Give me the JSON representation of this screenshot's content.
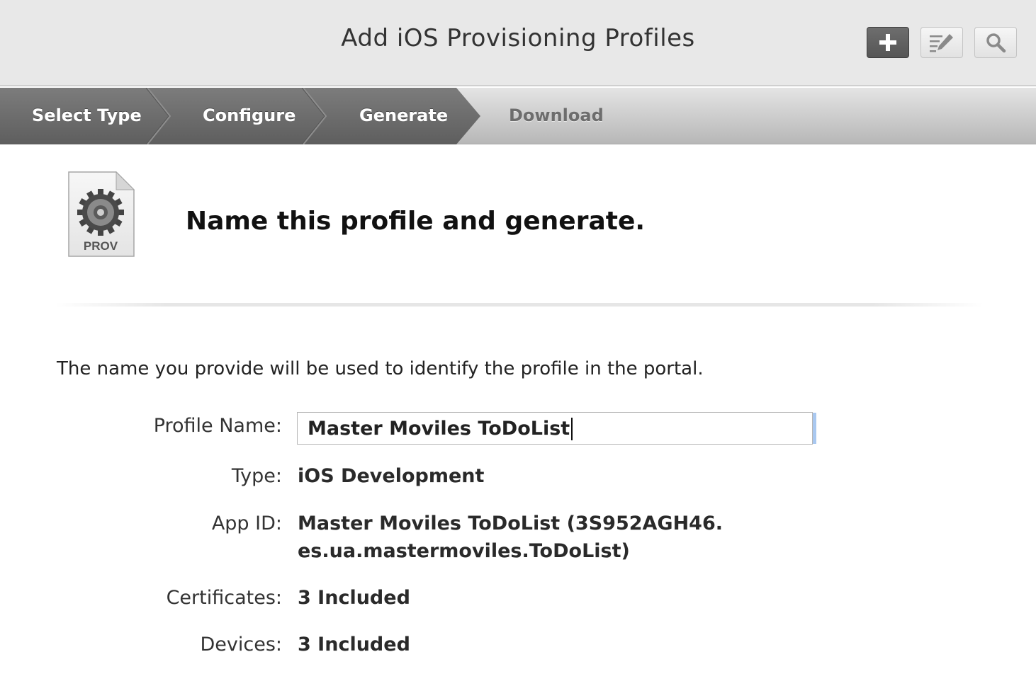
{
  "header": {
    "title": "Add iOS Provisioning Profiles",
    "buttons": [
      {
        "icon": "plus-icon"
      },
      {
        "icon": "edit-icon"
      },
      {
        "icon": "search-icon"
      }
    ]
  },
  "steps": [
    {
      "label": "Select Type",
      "state": "completed"
    },
    {
      "label": "Configure",
      "state": "completed"
    },
    {
      "label": "Generate",
      "state": "current"
    },
    {
      "label": "Download",
      "state": "upcoming"
    }
  ],
  "main": {
    "icon_label": "PROV",
    "heading": "Name this profile and generate.",
    "description": "The name you provide will be used to identify the profile in the portal.",
    "profile_name": {
      "label": "Profile Name:",
      "value": "Master Moviles ToDoList"
    },
    "type": {
      "label": "Type:",
      "value": "iOS Development"
    },
    "app_id": {
      "label": "App ID:",
      "value_line1": "Master Moviles ToDoList (3S952AGH46.",
      "value_line2": "es.ua.mastermoviles.ToDoList)"
    },
    "certificates": {
      "label": "Certificates:",
      "value": "3 Included"
    },
    "devices": {
      "label": "Devices:",
      "value": "3 Included"
    }
  },
  "colors": {
    "header_bg": "#e8e8e8",
    "step_active": "#6f6f6f",
    "step_inactive": "#c9c9c9",
    "input_focus": "#a9c8f0"
  }
}
